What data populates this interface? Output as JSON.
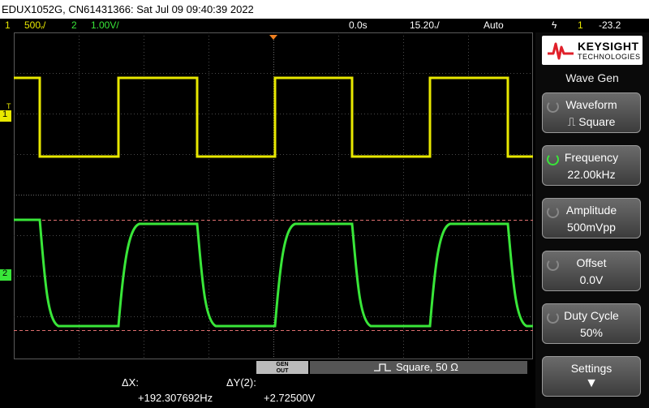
{
  "titlebar": {
    "text": "EDUX1052G, CN61431366: Sat Jul 09 09:40:39 2022"
  },
  "status": {
    "ch1_num": "1",
    "ch1_scale": "500 ⁄",
    "ch1_scale_full": "500∕",
    "ch2_num": "2",
    "ch2_scale": "1.00V/",
    "time_delay": "0.0s",
    "time_scale": "15.20∕",
    "trigger_mode": "Auto",
    "trigger_icon": "ϟ",
    "trigger_ch": "1",
    "trigger_level": "-23.2"
  },
  "channels": {
    "ch1_marker": "1",
    "ch2_marker": "2",
    "trigger_marker": "T"
  },
  "panel": {
    "brand": "KEYSIGHT",
    "brand_sub": "TECHNOLOGIES",
    "title": "Wave Gen",
    "softkeys": [
      {
        "line1": "Waveform",
        "line2": "⎍ Square"
      },
      {
        "line1": "Frequency",
        "line2": "22.00kHz"
      },
      {
        "line1": "Amplitude",
        "line2": "500mVpp"
      },
      {
        "line1": "Offset",
        "line2": "0.0V"
      },
      {
        "line1": "Duty Cycle",
        "line2": "50%"
      },
      {
        "line1": "Settings",
        "line2": "▼"
      }
    ]
  },
  "genbar": {
    "gen_out_l1": "GEN",
    "gen_out_l2": "OUT",
    "waveform_text": "Square, 50 Ω"
  },
  "measurements": {
    "dx_label": "ΔX:",
    "dx_value": "+192.307692Hz",
    "dy_label": "ΔY(2):",
    "dy_value": "+2.72500V"
  },
  "colors": {
    "ch1": "#e8e800",
    "ch2": "#39e639",
    "grid": "#4a4a4a",
    "cursor": "#e07070"
  }
}
